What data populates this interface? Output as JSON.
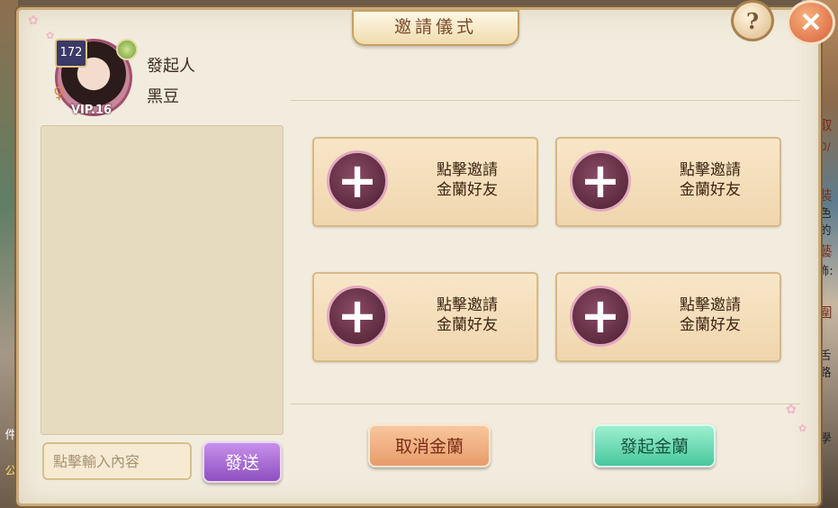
{
  "dialog": {
    "title": "邀請儀式",
    "help_symbol": "?",
    "close_symbol": "✕"
  },
  "initiator": {
    "role_label": "發起人",
    "name": "黑豆",
    "level": "172",
    "vip": "VIP.16",
    "gender_symbol": "♀"
  },
  "chat": {
    "input_placeholder": "點擊輸入內容",
    "send_label": "發送"
  },
  "invite_slots": [
    {
      "line1": "點擊邀請",
      "line2": "金蘭好友"
    },
    {
      "line1": "點擊邀請",
      "line2": "金蘭好友"
    },
    {
      "line1": "點擊邀請",
      "line2": "金蘭好友"
    },
    {
      "line1": "點擊邀請",
      "line2": "金蘭好友"
    }
  ],
  "actions": {
    "cancel_label": "取消金蘭",
    "start_label": "發起金蘭"
  },
  "background_fragments": [
    "取",
    "0/",
    "裝",
    "色的",
    "藝",
    "飾:",
    "圍",
    "舌路",
    "件",
    "公",
    "學"
  ],
  "colors": {
    "panel_bg": "#f1ecde",
    "title_text": "#7a4a2a",
    "send_button": "#a86ad6",
    "cancel_button": "#e89c6c",
    "start_button": "#47c79c",
    "close_button": "#d95f3a"
  }
}
